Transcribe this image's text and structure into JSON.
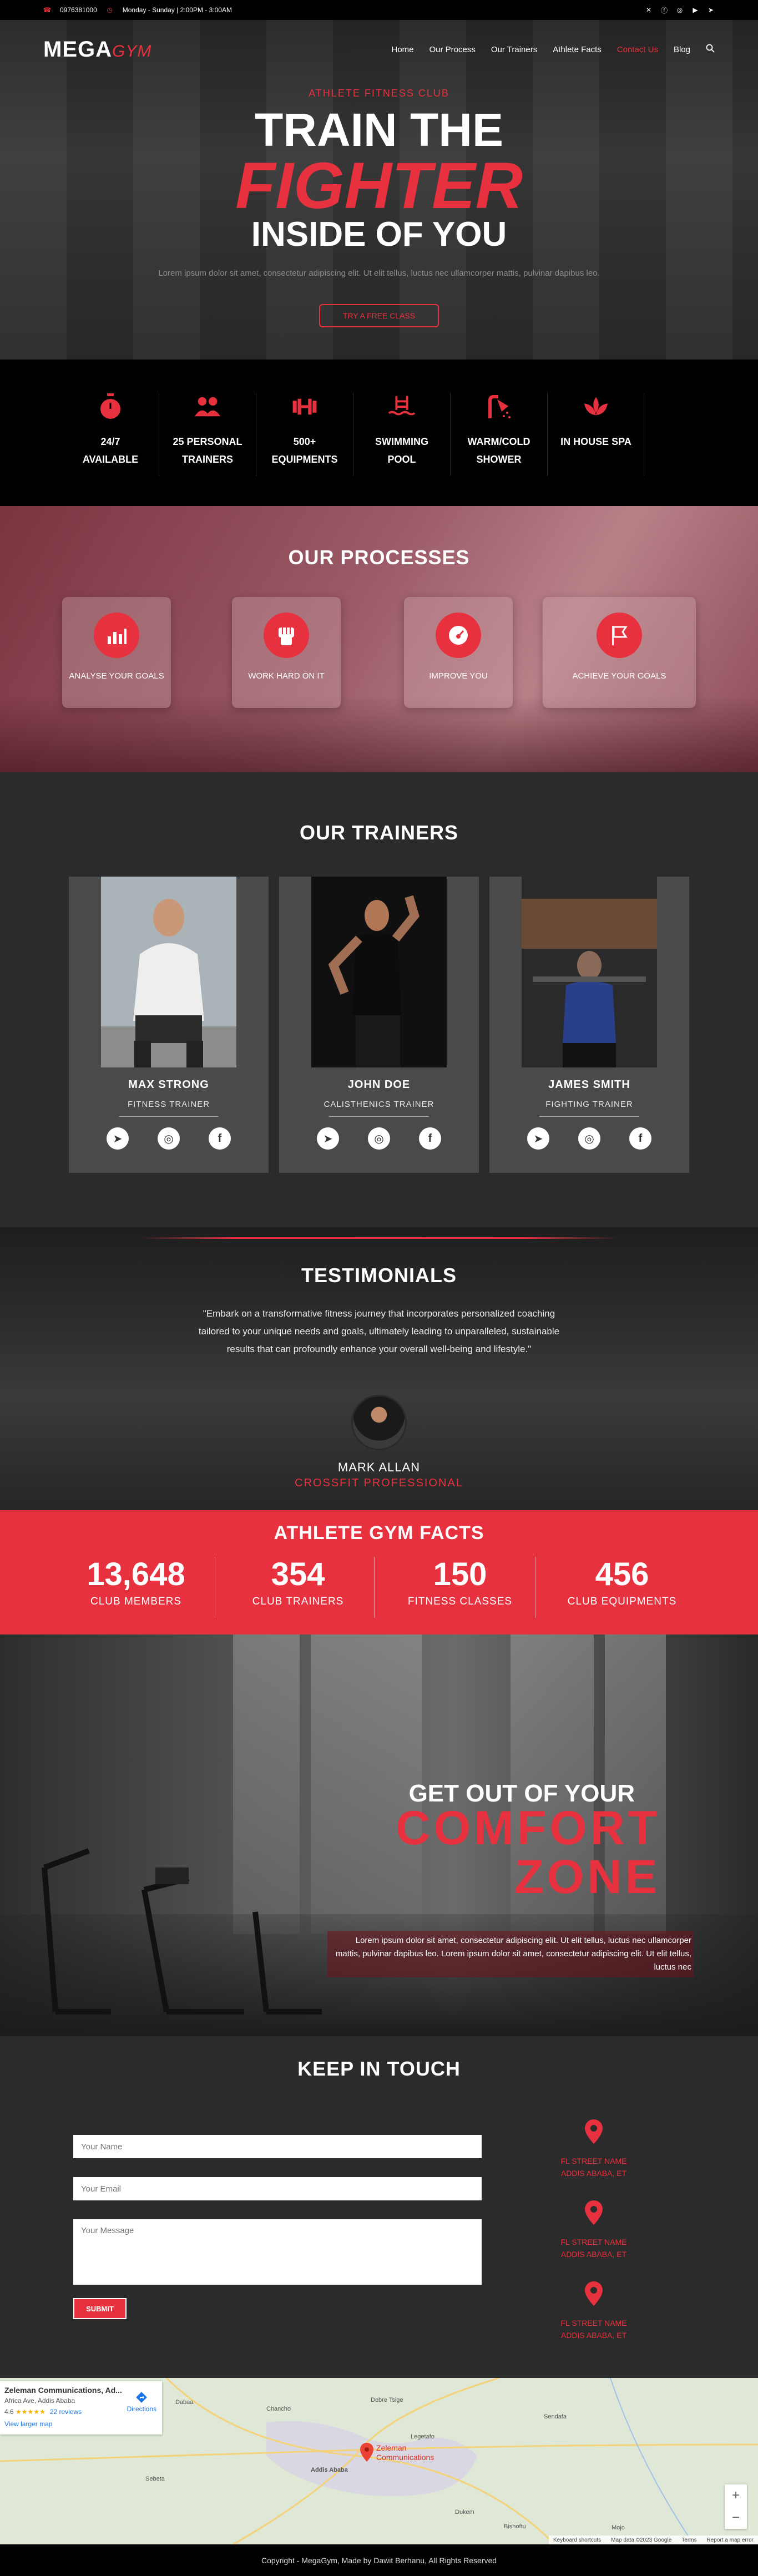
{
  "topbar": {
    "phone": "0976381000",
    "hours": "Monday - Sunday | 2:00PM - 3:00AM",
    "social_icons": [
      "x-icon",
      "facebook-icon",
      "instagram-icon",
      "youtube-icon",
      "telegram-icon"
    ]
  },
  "nav": {
    "logo_main": "MEGA",
    "logo_accent": "GYM",
    "items": [
      {
        "label": "Home"
      },
      {
        "label": "Our Process"
      },
      {
        "label": "Our Trainers"
      },
      {
        "label": "Athlete Facts"
      },
      {
        "label": "Contact Us",
        "active": true
      },
      {
        "label": "Blog"
      }
    ]
  },
  "hero": {
    "subtitle": "ATHLETE FITNESS CLUB",
    "line1": "TRAIN THE",
    "line2": "FIGHTER",
    "line3": "INSIDE OF YOU",
    "text": "Lorem ipsum dolor sit amet, consectetur adipiscing elit. Ut elit tellus, luctus nec ullamcorper mattis, pulvinar dapibus leo.",
    "button": "TRY A FREE CLASS"
  },
  "features": [
    {
      "icon": "stopwatch-icon",
      "line1": "24/7",
      "line2": "AVAILABLE"
    },
    {
      "icon": "users-icon",
      "line1": "25 PERSONAL",
      "line2": "TRAINERS"
    },
    {
      "icon": "dumbbell-icon",
      "line1": "500+",
      "line2": "EQUIPMENTS"
    },
    {
      "icon": "swimming-icon",
      "line1": "SWIMMING",
      "line2": "POOL"
    },
    {
      "icon": "shower-icon",
      "line1": "WARM/COLD",
      "line2": "SHOWER"
    },
    {
      "icon": "spa-icon",
      "line1": "IN HOUSE SPA",
      "line2": ""
    }
  ],
  "processes": {
    "title": "OUR PROCESSES",
    "items": [
      {
        "icon": "chart-icon",
        "label": "ANALYSE YOUR GOALS"
      },
      {
        "icon": "fist-icon",
        "label": "WORK HARD ON IT"
      },
      {
        "icon": "gauge-icon",
        "label": "IMPROVE YOU"
      },
      {
        "icon": "flag-icon",
        "label": "ACHIEVE YOUR GOALS"
      }
    ]
  },
  "trainers": {
    "title": "OUR TRAINERS",
    "items": [
      {
        "name": "MAX STRONG",
        "role": "FITNESS TRAINER"
      },
      {
        "name": "JOHN DOE",
        "role": "CALISTHENICS TRAINER"
      },
      {
        "name": "JAMES SMITH",
        "role": "FIGHTING TRAINER"
      }
    ]
  },
  "testimonials": {
    "title": "TESTIMONIALS",
    "quote": "\"Embark on a transformative fitness journey that incorporates personalized coaching tailored to your unique needs and goals, ultimately leading to unparalleled, sustainable results that can profoundly enhance your overall well-being and lifestyle.\"",
    "name": "MARK ALLAN",
    "role": "CROSSFIT PROFESSIONAL"
  },
  "facts": {
    "title": "ATHLETE GYM FACTS",
    "items": [
      {
        "value": "13,648",
        "label": "CLUB MEMBERS"
      },
      {
        "value": "354",
        "label": "CLUB TRAINERS"
      },
      {
        "value": "150",
        "label": "FITNESS CLASSES"
      },
      {
        "value": "456",
        "label": "CLUB EQUIPMENTS"
      }
    ]
  },
  "comfort": {
    "line1": "GET OUT OF YOUR",
    "line2": "COMFORT",
    "line3": "ZONE",
    "text": "Lorem ipsum dolor sit amet, consectetur adipiscing elit. Ut elit tellus, luctus nec ullamcorper mattis, pulvinar dapibus leo. Lorem ipsum dolor sit amet, consectetur adipiscing elit. Ut elit tellus, luctus nec"
  },
  "contact": {
    "title": "KEEP IN TOUCH",
    "name_placeholder": "Your Name",
    "email_placeholder": "Your Email",
    "message_placeholder": "Your Message",
    "submit": "SUBMIT",
    "locations": [
      {
        "line1": "FL STREET NAME",
        "line2": "ADDIS ABABA, ET"
      },
      {
        "line1": "FL STREET NAME",
        "line2": "ADDIS ABABA, ET"
      },
      {
        "line1": "FL STREET NAME",
        "line2": "ADDIS ABABA, ET"
      }
    ]
  },
  "map": {
    "place": "Zeleman Communications, Ad...",
    "address": "Africa Ave, Addis Ababa",
    "rating": "4.6",
    "stars": "★★★★★",
    "reviews": "22 reviews",
    "larger": "View larger map",
    "directions": "Directions",
    "marker_label_1": "Zeleman",
    "marker_label_2": "Communications",
    "towns": [
      "Dabaa",
      "Debre Tsige",
      "Chancho",
      "Sendafa",
      "Addis Ababa",
      "Sebeta",
      "Legetafo",
      "Bishoftu",
      "Dukem",
      "Mojo"
    ],
    "footer_shortcuts": "Keyboard shortcuts",
    "footer_data": "Map data ©2023 Google",
    "footer_terms": "Terms",
    "footer_report": "Report a map error"
  },
  "footer": {
    "text": "Copyright - MegaGym, Made by Dawit Berhanu, All Rights Reserved"
  }
}
